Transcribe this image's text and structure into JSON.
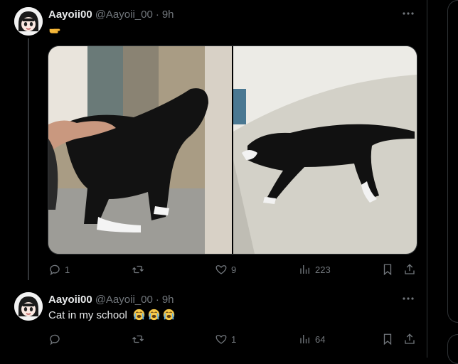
{
  "colors": {
    "background": "#000000",
    "text": "#e7e9ea",
    "muted": "#71767b",
    "divider": "#2f3336"
  },
  "tweets": [
    {
      "author": {
        "name": "Aayoii00",
        "handle": "@Aayoii_00",
        "separator": "·",
        "time": "9h"
      },
      "text": "",
      "text_emoji": "pointing-hand-emoji",
      "media": {
        "count": 2,
        "descriptions": [
          "cat-being-petted-photo",
          "cat-lying-on-floor-photo"
        ]
      },
      "actions": {
        "replies": "1",
        "retweets": "",
        "likes": "9",
        "views": "223"
      }
    },
    {
      "author": {
        "name": "Aayoii00",
        "handle": "@Aayoii_00",
        "separator": "·",
        "time": "9h"
      },
      "text": "Cat in my school",
      "text_emoji": "loudly-crying-face-emoji x3",
      "actions": {
        "replies": "",
        "retweets": "",
        "likes": "1",
        "views": "64"
      }
    }
  ],
  "icons": {
    "reply": "reply-icon",
    "retweet": "retweet-icon",
    "like": "heart-icon",
    "views": "views-icon",
    "bookmark": "bookmark-icon",
    "share": "share-icon",
    "more": "more-icon"
  }
}
